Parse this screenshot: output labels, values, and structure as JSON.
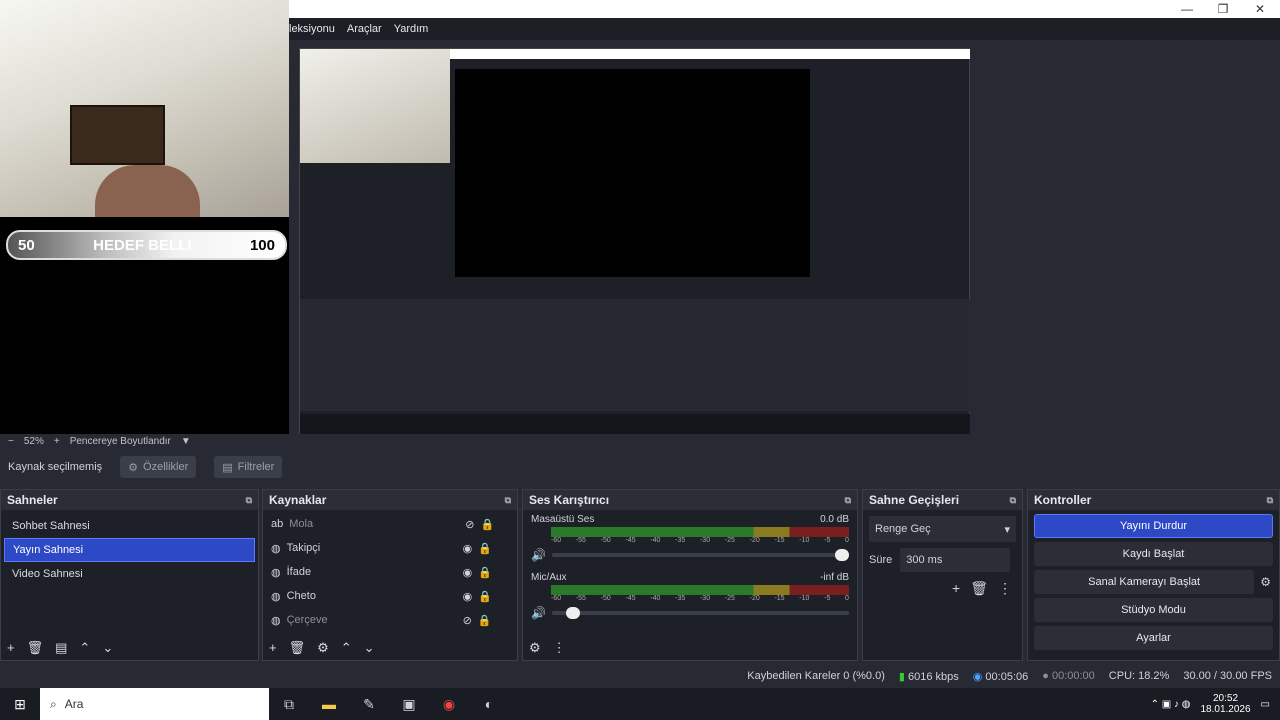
{
  "window": {
    "minimize": "—",
    "maximize": "❐",
    "close": "✕"
  },
  "menu": [
    "leksiyonu",
    "Araçlar",
    "Yardım"
  ],
  "overlay": {
    "left": "50",
    "label": "HEDEF BELLI",
    "right": "100"
  },
  "zoom": {
    "minus": "−",
    "value": "52%",
    "plus": "+",
    "fit": "Pencereye Boyutlandır"
  },
  "source_bar": {
    "status": "Kaynak seçilmemiş",
    "properties": "Özellikler",
    "filters": "Filtreler"
  },
  "scenes": {
    "title": "Sahneler",
    "items": [
      "Sohbet Sahnesi",
      "Yayın Sahnesi",
      "Video Sahnesi"
    ],
    "selected_index": 1
  },
  "sources": {
    "title": "Kaynaklar",
    "items": [
      {
        "name": "Mola",
        "visible": false
      },
      {
        "name": "Takipçi",
        "visible": true
      },
      {
        "name": "İfade",
        "visible": true
      },
      {
        "name": "Cheto",
        "visible": true
      },
      {
        "name": "Çerçeve",
        "visible": false
      }
    ]
  },
  "mixer": {
    "title": "Ses Karıştırıcı",
    "channels": [
      {
        "name": "Masaüstü Ses",
        "level": "0.0 dB",
        "volume": 1.0
      },
      {
        "name": "Mic/Aux",
        "level": "-inf dB",
        "volume": 0.05
      }
    ],
    "ticks": [
      "-60",
      "-55",
      "-50",
      "-45",
      "-40",
      "-35",
      "-30",
      "-25",
      "-20",
      "-15",
      "-10",
      "-5",
      "0"
    ]
  },
  "transitions": {
    "title": "Sahne Geçişleri",
    "type": "Renge Geç",
    "duration_label": "Süre",
    "duration": "300 ms"
  },
  "controls": {
    "title": "Kontroller",
    "buttons": [
      "Yayını Durdur",
      "Kaydı Başlat",
      "Sanal Kamerayı Başlat",
      "Stüdyo Modu",
      "Ayarlar"
    ]
  },
  "status": {
    "dropped": "Kaybedilen Kareler 0 (%0.0)",
    "bitrate": "6016 kbps",
    "stream_time": "00:05:06",
    "rec_time": "00:00:00",
    "cpu": "CPU: 18.2%",
    "fps": "30.00 / 30.00 FPS"
  },
  "taskbar": {
    "search": "Ara",
    "time": "20:52",
    "date": "18.01.2026"
  }
}
